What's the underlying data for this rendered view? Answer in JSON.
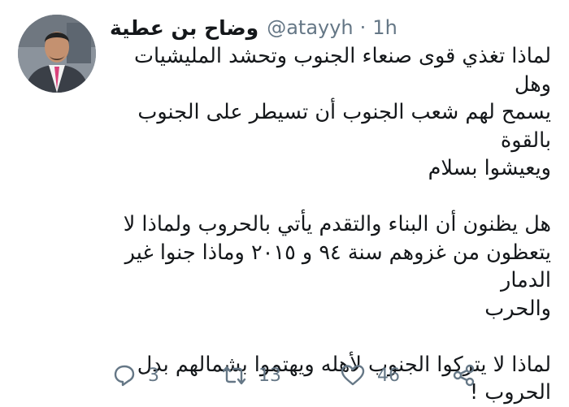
{
  "tweet": {
    "author_name": "وضاح بن عطية",
    "handle": "@atayyh",
    "separator": "·",
    "time": "1h",
    "paragraphs": [
      [
        "لماذا تغذي قوى صنعاء الجنوب وتحشد المليشيات وهل",
        "يسمح لهم شعب الجنوب أن تسيطر على الجنوب بالقوة",
        "ويعيشوا بسلام"
      ],
      [
        "هل يظنون أن البناء والتقدم يأتي بالحروب ولماذا لا",
        "يتعظون من غزوهم سنة ٩٤ و ٢٠١٥ وماذا جنوا غير الدمار",
        "والحرب"
      ],
      [
        "لماذا لا يتركوا الجنوب لأهله ويهتموا بشمالهم بدل",
        "الحروب !"
      ]
    ]
  },
  "actions": {
    "reply_count": "3",
    "retweet_count": "13",
    "like_count": "46"
  },
  "icons": [
    "avatar",
    "reply-icon",
    "retweet-icon",
    "like-icon",
    "share-icon"
  ],
  "colors": {
    "text": "#14171a",
    "secondary": "#657786",
    "background": "#ffffff"
  }
}
